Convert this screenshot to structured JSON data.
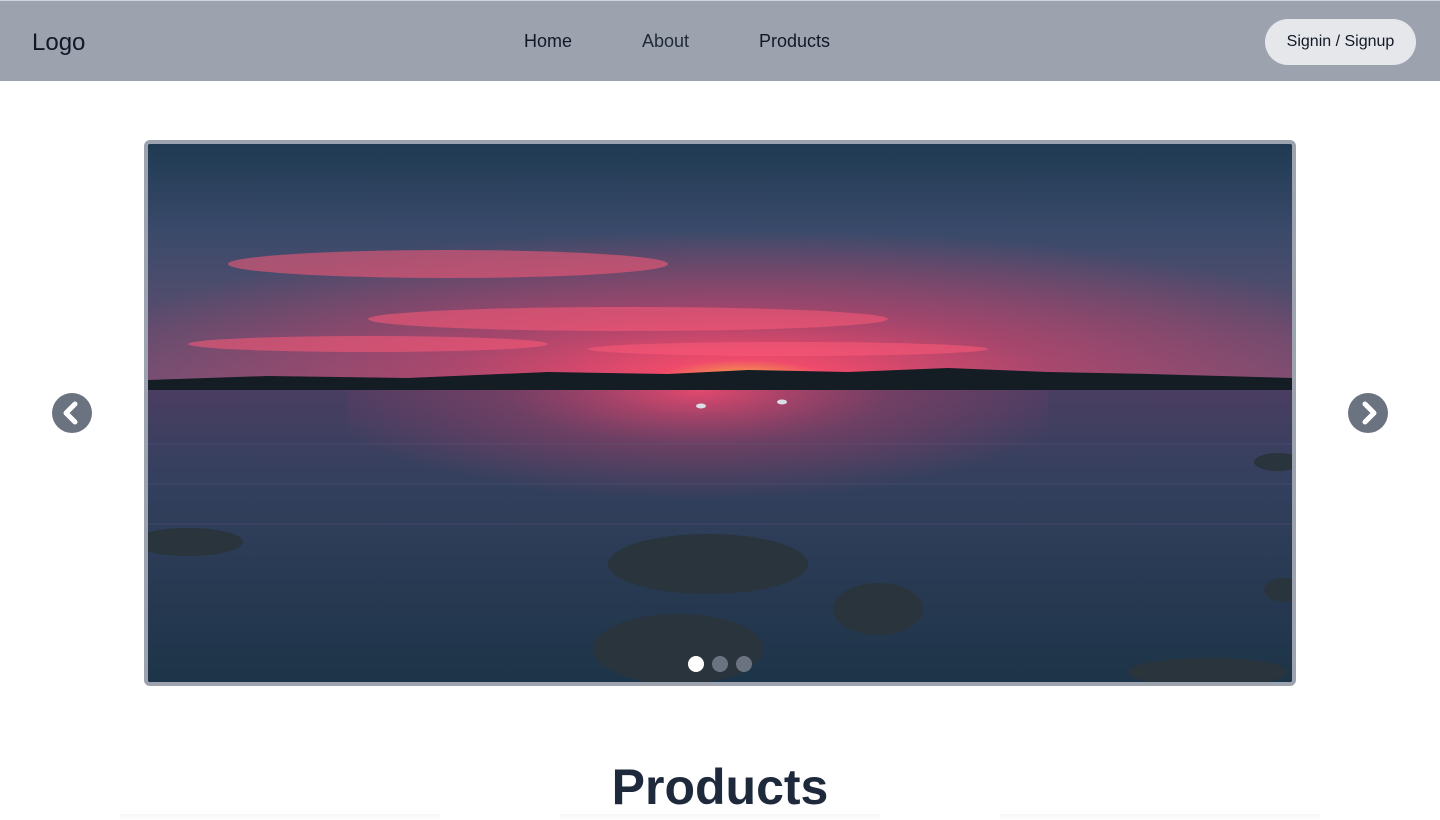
{
  "header": {
    "logo": "Logo",
    "nav": [
      {
        "label": "Home"
      },
      {
        "label": "About"
      },
      {
        "label": "Products"
      }
    ],
    "signin_label": "Signin / Signup",
    "background": "#9ca3af"
  },
  "carousel": {
    "slide_count": 3,
    "active_index": 0,
    "prev_icon": "chevron-left-icon",
    "next_icon": "chevron-right-icon"
  },
  "products": {
    "title": "Products"
  }
}
